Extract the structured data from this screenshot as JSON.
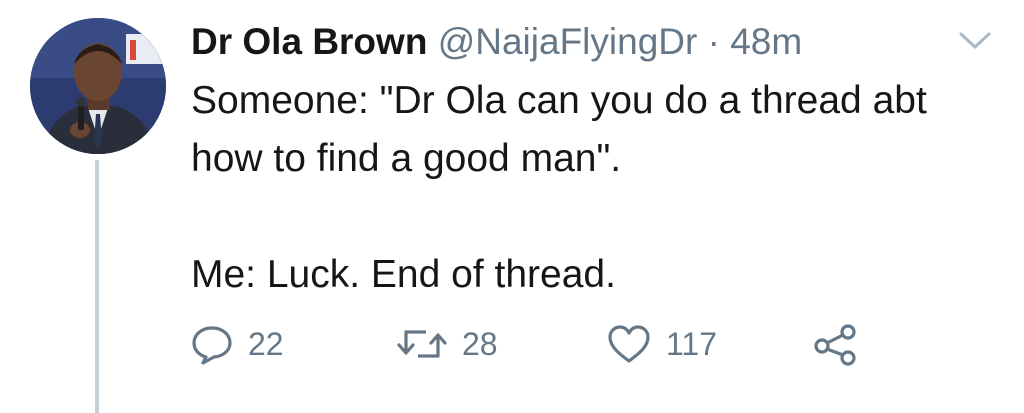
{
  "tweet": {
    "author_name": "Dr Ola Brown",
    "handle": "@NaijaFlyingDr",
    "separator": "·",
    "time": "48m",
    "text_line1": "Someone: \"Dr Ola can you do a thread abt",
    "text_line2": "how to find a good man\".",
    "text_line3": "Me: Luck. End of thread."
  },
  "actions": {
    "replies": "22",
    "retweets": "28",
    "likes": "117"
  },
  "icons": {
    "reply": "speech-bubble-icon",
    "retweet": "retweet-arrows-icon",
    "like": "heart-icon",
    "share": "share-nodes-icon",
    "menu": "chevron-down-icon"
  },
  "colors": {
    "text": "#14171a",
    "muted": "#657786",
    "thread_line": "#c4cfd6"
  }
}
